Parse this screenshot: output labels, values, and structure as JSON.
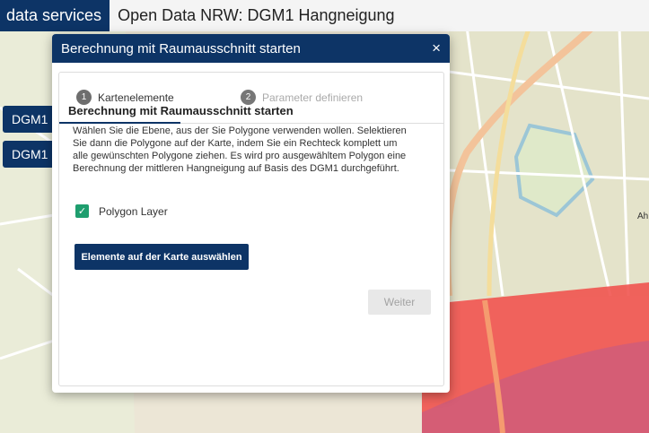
{
  "topbar": {
    "brand": "data services",
    "app_title": "Open Data NRW: DGM1 Hangneigung"
  },
  "layer_buttons": [
    {
      "label": "DGM1 -"
    },
    {
      "label": "DGM1 -"
    }
  ],
  "dialog": {
    "title": "Berechnung mit Raumausschnitt starten",
    "close_label": "×",
    "steps": [
      {
        "number": "1",
        "label": "Kartenelemente",
        "active": true
      },
      {
        "number": "2",
        "label": "Parameter definieren",
        "active": false
      }
    ],
    "section_title": "Berechnung mit Raumausschnitt starten",
    "description": "Wählen Sie die Ebene, aus der Sie Polygone verwenden wollen. Selektieren Sie dann die Polygone auf der Karte, indem Sie ein Rechteck komplett um alle gewünschten Polygone ziehen. Es wird pro ausgewähltem Polygon eine Berechnung der mittleren Hangneigung auf Basis des DGM1 durchgeführt.",
    "checkbox": {
      "label": "Polygon Layer",
      "checked": true
    },
    "select_button": "Elemente auf der Karte auswählen",
    "next_button": "Weiter"
  },
  "map": {
    "highlight_color": "#f0504b",
    "labels": [
      "Ah"
    ]
  }
}
